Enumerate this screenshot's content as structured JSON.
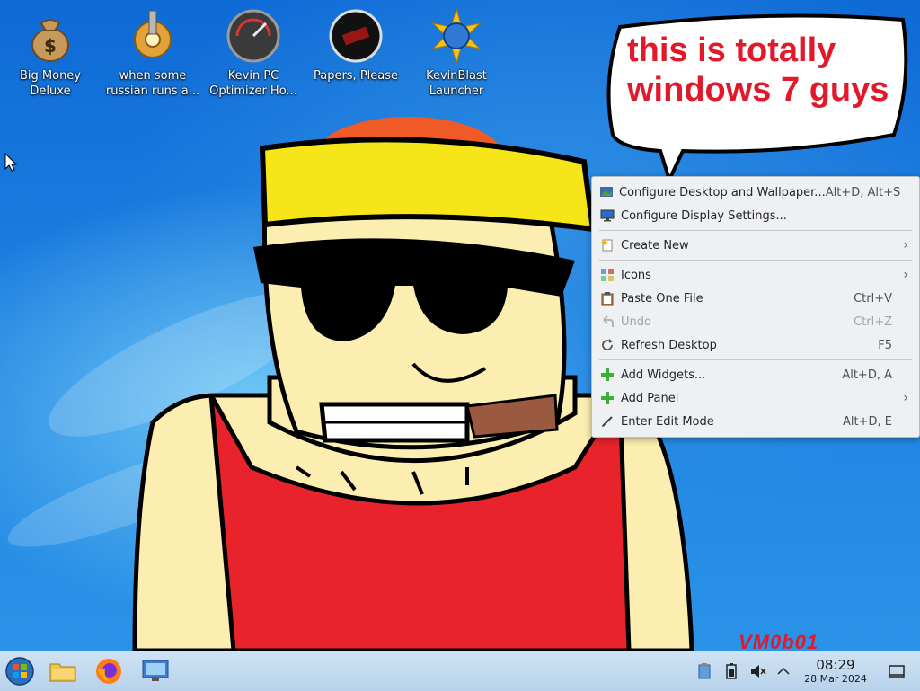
{
  "desktop_icons": [
    {
      "label": "Big Money Deluxe",
      "icon": "money-bag-icon"
    },
    {
      "label": "when some russian runs a...",
      "icon": "gear-icon"
    },
    {
      "label": "Kevin PC Optimizer Ho...",
      "icon": "speedometer-icon"
    },
    {
      "label": "Papers, Please",
      "icon": "papers-please-icon"
    },
    {
      "label": "KevinBlast Launcher",
      "icon": "starburst-icon"
    }
  ],
  "bubble": {
    "line1": "this is totally",
    "line2": "windows 7 guys"
  },
  "context_menu": {
    "items": [
      {
        "label": "Configure Desktop and Wallpaper...",
        "shortcut": "Alt+D, Alt+S",
        "icon": "wallpaper-icon"
      },
      {
        "label": "Configure Display Settings...",
        "shortcut": "",
        "icon": "display-icon"
      },
      {
        "label": "Create New",
        "shortcut": "",
        "icon": "create-new-icon"
      },
      {
        "label": "Icons",
        "shortcut": "",
        "icon": "icons-icon"
      },
      {
        "label": "Paste One File",
        "shortcut": "Ctrl+V",
        "icon": "paste-icon"
      },
      {
        "label": "Undo",
        "shortcut": "Ctrl+Z",
        "icon": "undo-icon"
      },
      {
        "label": "Refresh Desktop",
        "shortcut": "F5",
        "icon": "refresh-icon"
      },
      {
        "label": "Add Widgets...",
        "shortcut": "Alt+D, A",
        "icon": "add-icon"
      },
      {
        "label": "Add Panel",
        "shortcut": "",
        "icon": "add-icon"
      },
      {
        "label": "Enter Edit Mode",
        "shortcut": "Alt+D, E",
        "icon": "edit-icon"
      }
    ]
  },
  "taskbar": {
    "apps": [
      "start-orb-icon",
      "file-manager-icon",
      "firefox-icon",
      "system-settings-icon"
    ],
    "tray": [
      "clipboard-icon",
      "battery-icon",
      "volume-muted-icon",
      "chevron-up-icon"
    ],
    "clock": {
      "time": "08:29",
      "date": "28 Mar 2024"
    }
  },
  "watermark": "VM0b01",
  "colors": {
    "accent_red": "#e01a2a",
    "menu_bg": "#eff0f1",
    "taskbar": "#c4dbef"
  }
}
